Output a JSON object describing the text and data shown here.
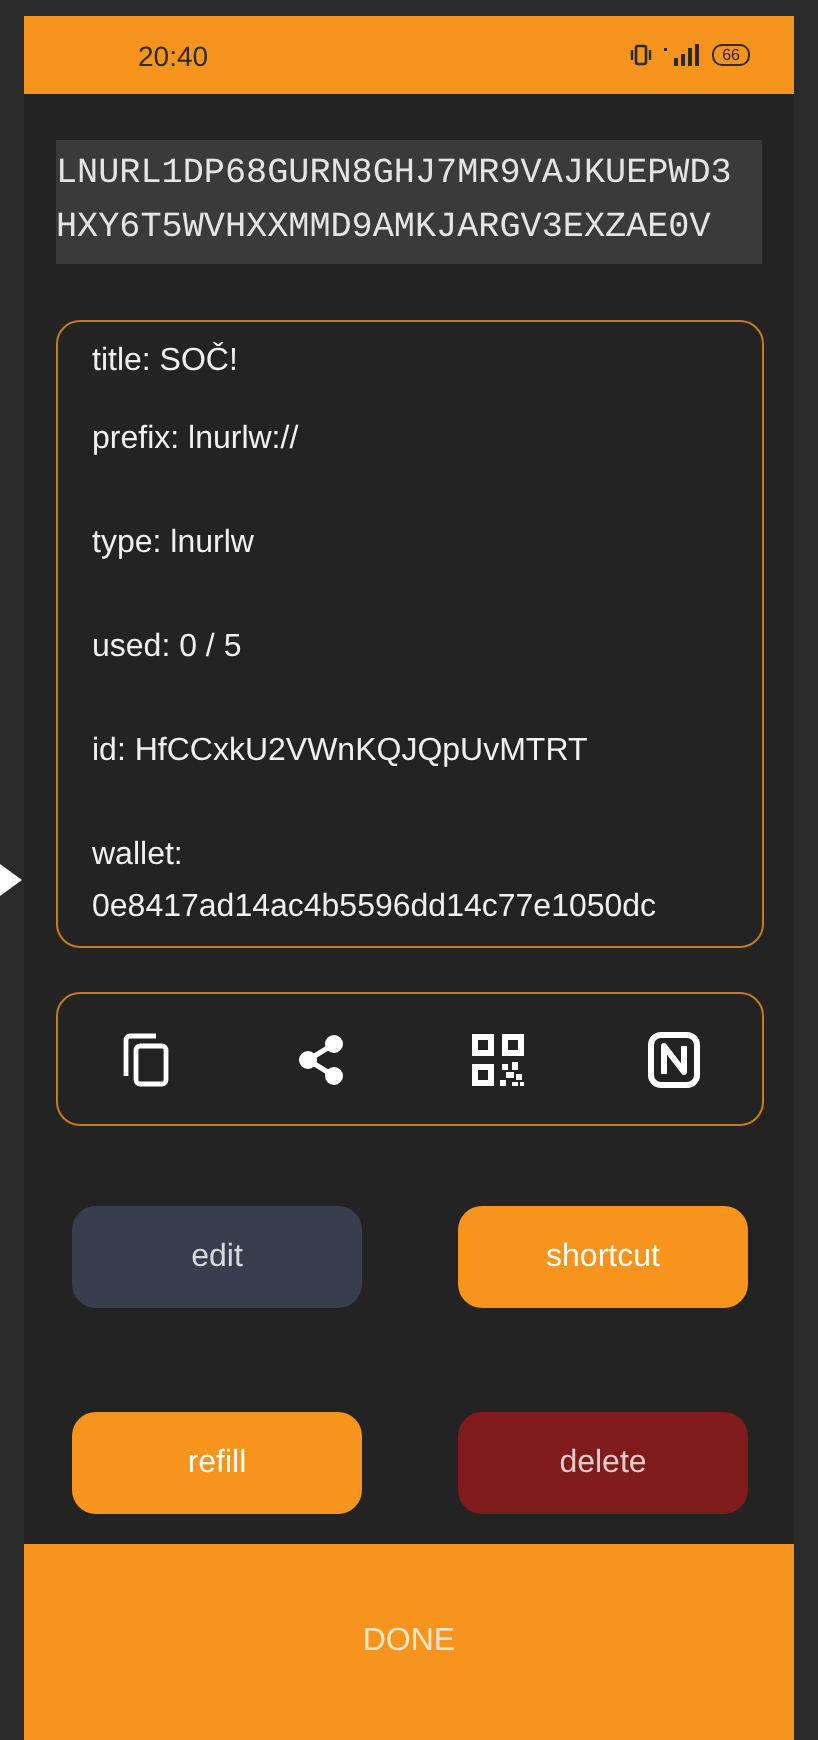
{
  "status_bar": {
    "time": "20:40",
    "battery": "66"
  },
  "lnurl": "LNURL1DP68GURN8GHJ7MR9VAJKUEPWD3HXY6T5WVHXXMMD9AMKJARGV3EXZAE0V",
  "details": [
    "title: SOČ!",
    "prefix: lnurlw://",
    "type: lnurlw",
    "used: 0 / 5",
    "id: HfCCxkU2VWnKQJQpUvMTRT",
    "wallet: 0e8417ad14ac4b5596dd14c77e1050dc"
  ],
  "actions": [
    {
      "kind": "copy"
    },
    {
      "kind": "share"
    },
    {
      "kind": "qr"
    },
    {
      "kind": "nfc"
    }
  ],
  "buttons": [
    {
      "label": "edit",
      "kind": "secondary"
    },
    {
      "label": "shortcut",
      "kind": "primary"
    },
    {
      "label": "refill",
      "kind": "primary"
    },
    {
      "label": "delete",
      "kind": "danger"
    }
  ],
  "done_button": "DONE"
}
